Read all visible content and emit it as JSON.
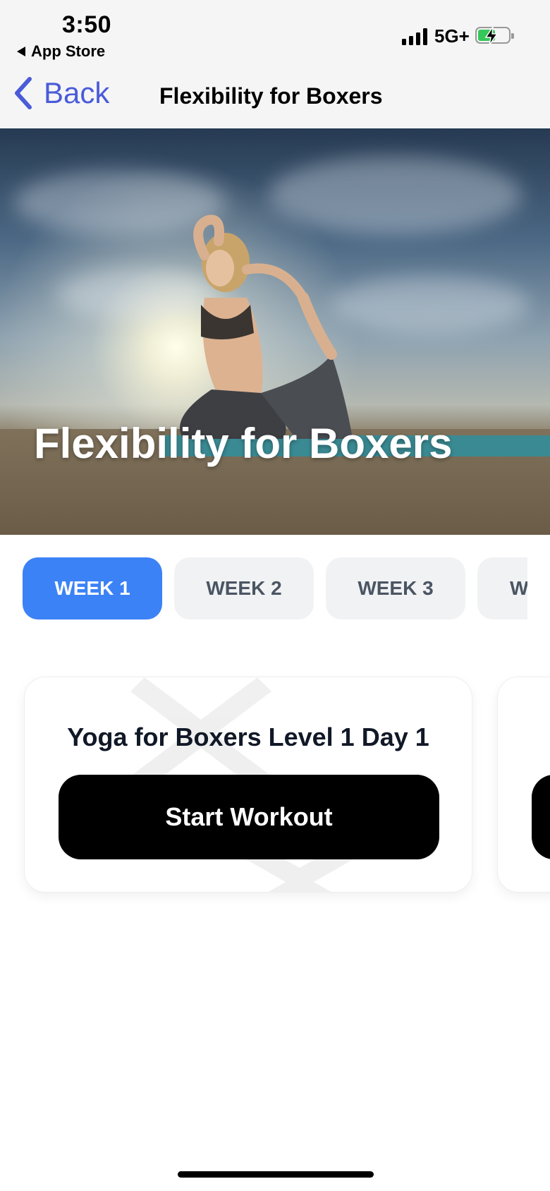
{
  "status_bar": {
    "time": "3:50",
    "back_app_label": "App Store",
    "network": "5G+",
    "battery_state": "charging"
  },
  "nav": {
    "back_label": "Back",
    "title": "Flexibility for Boxers"
  },
  "hero": {
    "title": "Flexibility for Boxers"
  },
  "weeks": {
    "selected": "WEEK 1",
    "tabs": [
      "WEEK 1",
      "WEEK 2",
      "WEEK 3",
      "W"
    ]
  },
  "workout_card": {
    "title": "Yoga for Boxers Level 1 Day 1",
    "button_label": "Start Workout"
  },
  "colors": {
    "accent": "#3b82f6",
    "nav_link": "#4a5bd8",
    "battery_fill": "#34c759"
  }
}
